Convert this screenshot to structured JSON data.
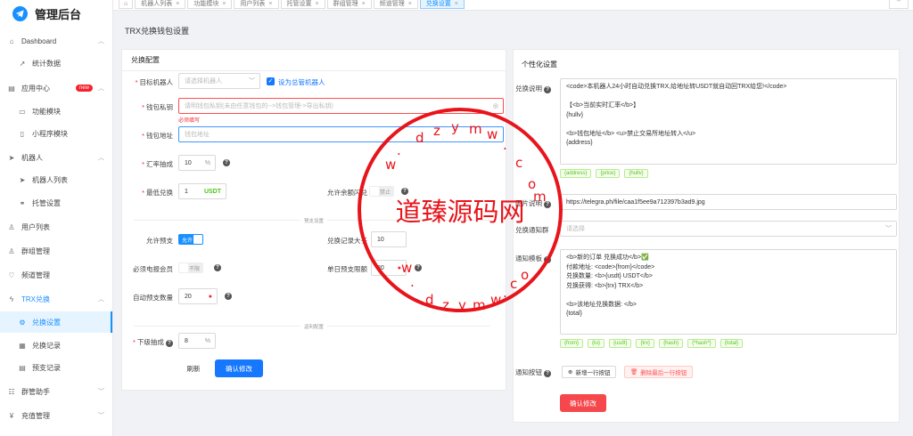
{
  "app": {
    "title": "管理后台"
  },
  "sidebar": {
    "items": [
      {
        "label": "Dashboard",
        "icon": "home-icon"
      },
      {
        "label": "统计数据",
        "icon": "trend-icon"
      },
      {
        "label": "应用中心",
        "icon": "app-icon",
        "badge": "new"
      },
      {
        "label": "功能模块",
        "icon": "module-icon"
      },
      {
        "label": "小程序模块",
        "icon": "miniapp-icon"
      },
      {
        "label": "机器人",
        "icon": "send-icon"
      },
      {
        "label": "机器人列表",
        "icon": "send-icon"
      },
      {
        "label": "托管设置",
        "icon": "link-icon"
      },
      {
        "label": "用户列表",
        "icon": "user-icon"
      },
      {
        "label": "群组管理",
        "icon": "group-icon"
      },
      {
        "label": "频道管理",
        "icon": "heart-icon"
      },
      {
        "label": "TRX兑换",
        "icon": "flash-icon"
      },
      {
        "label": "兑换设置",
        "icon": "gear-icon"
      },
      {
        "label": "兑换记录",
        "icon": "table-icon"
      },
      {
        "label": "预支记录",
        "icon": "doc-icon"
      },
      {
        "label": "群管助手",
        "icon": "assistant-icon"
      },
      {
        "label": "充值管理",
        "icon": "yen-icon"
      }
    ]
  },
  "tabs": [
    {
      "label": "机器人列表"
    },
    {
      "label": "功能模块"
    },
    {
      "label": "用户列表"
    },
    {
      "label": "托管设置"
    },
    {
      "label": "群组管理"
    },
    {
      "label": "频道管理"
    },
    {
      "label": "兑换设置"
    }
  ],
  "page": {
    "title": "TRX兑换钱包设置"
  },
  "exchange": {
    "title": "兑换配置",
    "target_bot_label": "目标机器人",
    "target_bot_placeholder": "请选择机器人",
    "set_total_label": "设为总管机器人",
    "wallet_key_label": "钱包私钥",
    "wallet_key_placeholder": "请明钱包私钥(未由任意钱包的-->钱包管理->导出私钥)",
    "wallet_key_error": "必须填写",
    "wallet_addr_label": "钱包地址",
    "wallet_addr_placeholder": "钱包地址",
    "rate_label": "汇率抽成",
    "rate_value": "10",
    "rate_suffix": "%",
    "min_label": "最低兑换",
    "min_value": "1",
    "min_suffix": "USDT",
    "allow_flash_label": "允许余额闪兑",
    "allow_flash_value": "禁止",
    "section_advance": "预支设置",
    "allow_advance_label": "允许预支",
    "allow_advance_value": "允许",
    "record_max_label": "兑换记录大于",
    "record_max_value": "10",
    "must_member_label": "必须电报会员",
    "must_member_value": "不限",
    "single_limit_label": "单日预支限额",
    "single_limit_value": "30",
    "auto_count_label": "自动预支数量",
    "auto_count_value": "20",
    "section_distribution": "返利配置",
    "sub_rate_label": "下级抽成",
    "sub_rate_value": "8",
    "sub_rate_suffix": "%",
    "reset_label": "刷新",
    "submit_label": "确认修改"
  },
  "custom": {
    "title": "个性化设置",
    "desc_label": "兑换说明",
    "desc_value": "<code>本机器人24小时自动兑换TRX,给地址转USDT就自动回TRX给您!</code>\n\n【<b>当前实时汇率</b>】\n{hullv}\n\n<b>钱包地址</b> <u>禁止交易所地址转入</u>\n{address}",
    "desc_tags": [
      "{address}",
      "{price}",
      "{hullv}"
    ],
    "image_label": "图片说明",
    "image_value": "https://telegra.ph/file/caa1f5ee9a712397b3ad9.jpg",
    "notify_label": "兑换通知群",
    "notify_placeholder": "请选择",
    "template_label": "通知模板",
    "template_value": "<b>新的订单 兑换成功</b>✅\n付款地址: <code>{from}</code>\n兑换数量: <b>{usdt} USDT</b>\n兑换获得: <b>{trx} TRX</b>\n\n<b>该地址兑换数据: </b>\n{total}",
    "template_tags": [
      "{from}",
      "{to}",
      "{usdt}",
      "{trx}",
      "{hash}",
      "{*hash*}",
      "{total}"
    ],
    "buttons_label": "通知按钮",
    "add_row_label": "新增一行按钮",
    "del_row_label": "删除最后一行按钮",
    "submit_label": "确认修改"
  },
  "watermark": {
    "text": "道臻源码网",
    "url": "www.dzymw.com"
  }
}
